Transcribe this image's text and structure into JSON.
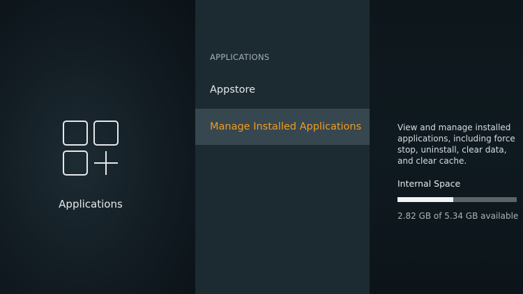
{
  "left": {
    "icon": "applications-grid-plus-icon",
    "label": "Applications"
  },
  "menu": {
    "heading": "APPLICATIONS",
    "items": [
      {
        "label": "Appstore",
        "selected": false
      },
      {
        "label": "Manage Installed Applications",
        "selected": true
      }
    ]
  },
  "details": {
    "description": "View and manage installed applications, including force stop, uninstall, clear data, and clear cache.",
    "storage_title": "Internal Space",
    "storage_used_fraction": 0.47,
    "storage_text": "2.82 GB of 5.34 GB available"
  },
  "colors": {
    "accent": "#f39c1f",
    "selected_row": "#364750",
    "middle_panel": "#1c2a31"
  }
}
